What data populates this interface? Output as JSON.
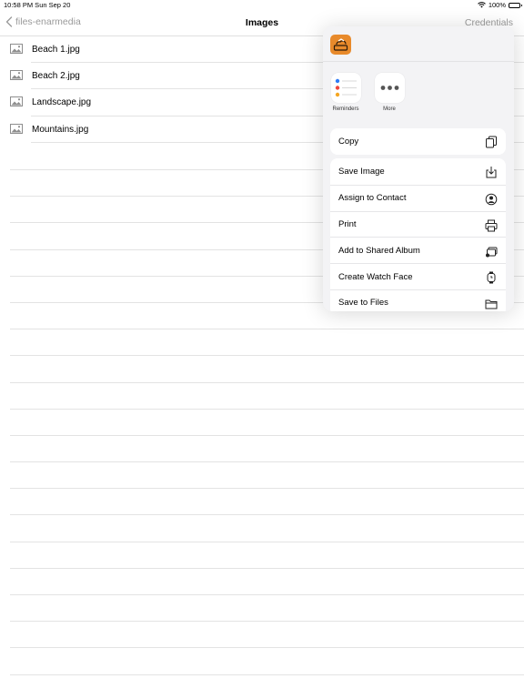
{
  "status_bar": {
    "time_date": "10:58 PM   Sun Sep 20",
    "battery": "100%",
    "battery_level": 1.0
  },
  "nav": {
    "back_label": "files-enarmedia",
    "title": "Images",
    "right_label": "Credentials"
  },
  "files": [
    {
      "name": "Beach 1.jpg",
      "icon": "image-file-icon"
    },
    {
      "name": "Beach 2.jpg",
      "icon": "image-file-icon"
    },
    {
      "name": "Landscape.jpg",
      "icon": "image-file-icon"
    },
    {
      "name": "Mountains.jpg",
      "icon": "image-file-icon"
    }
  ],
  "share_sheet": {
    "apps": [
      {
        "label": "Reminders",
        "icon": "reminders-icon"
      },
      {
        "label": "More",
        "icon": "more-icon"
      }
    ],
    "copy_group": [
      {
        "label": "Copy",
        "icon": "copy-icon"
      }
    ],
    "actions": [
      {
        "label": "Save Image",
        "icon": "save-image-icon"
      },
      {
        "label": "Assign to Contact",
        "icon": "contact-icon"
      },
      {
        "label": "Print",
        "icon": "print-icon"
      },
      {
        "label": "Add to Shared Album",
        "icon": "shared-album-icon"
      },
      {
        "label": "Create Watch Face",
        "icon": "watch-icon"
      },
      {
        "label": "Save to Files",
        "icon": "folder-icon"
      }
    ]
  },
  "colors": {
    "accent_gray": "#9a9a9a",
    "app_icon_orange": "#e88a2b"
  }
}
